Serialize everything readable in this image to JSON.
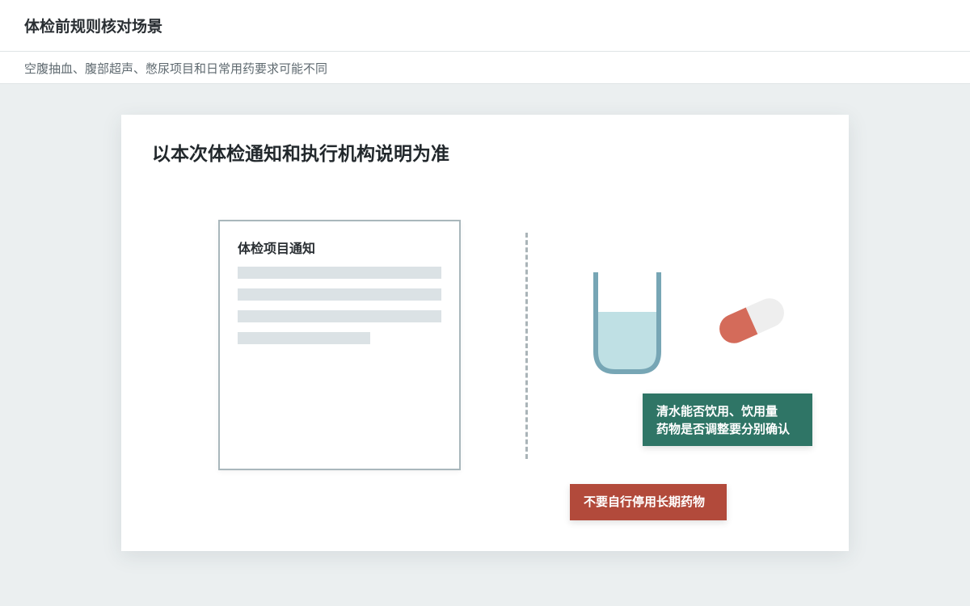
{
  "header": {
    "title": "体检前规则核对场景",
    "subtitle": "空腹抽血、腹部超声、憋尿项目和日常用药要求可能不同"
  },
  "card": {
    "title": "以本次体检通知和执行机构说明为准",
    "notice": {
      "title": "体检项目通知"
    },
    "tags": {
      "water_line1": "清水能否饮用、饮用量",
      "water_line2": "药物是否调整要分别确认",
      "medication": "不要自行停用长期药物"
    }
  },
  "icons": {
    "cup": "water-cup-icon",
    "pill": "pill-capsule-icon"
  },
  "colors": {
    "green_tag": "#2f7566",
    "red_tag": "#b24a3b",
    "water": "#bfe0e4",
    "cup_outline": "#77a6b5",
    "pill_red": "#d46b5a",
    "pill_white": "#eeeeee"
  }
}
